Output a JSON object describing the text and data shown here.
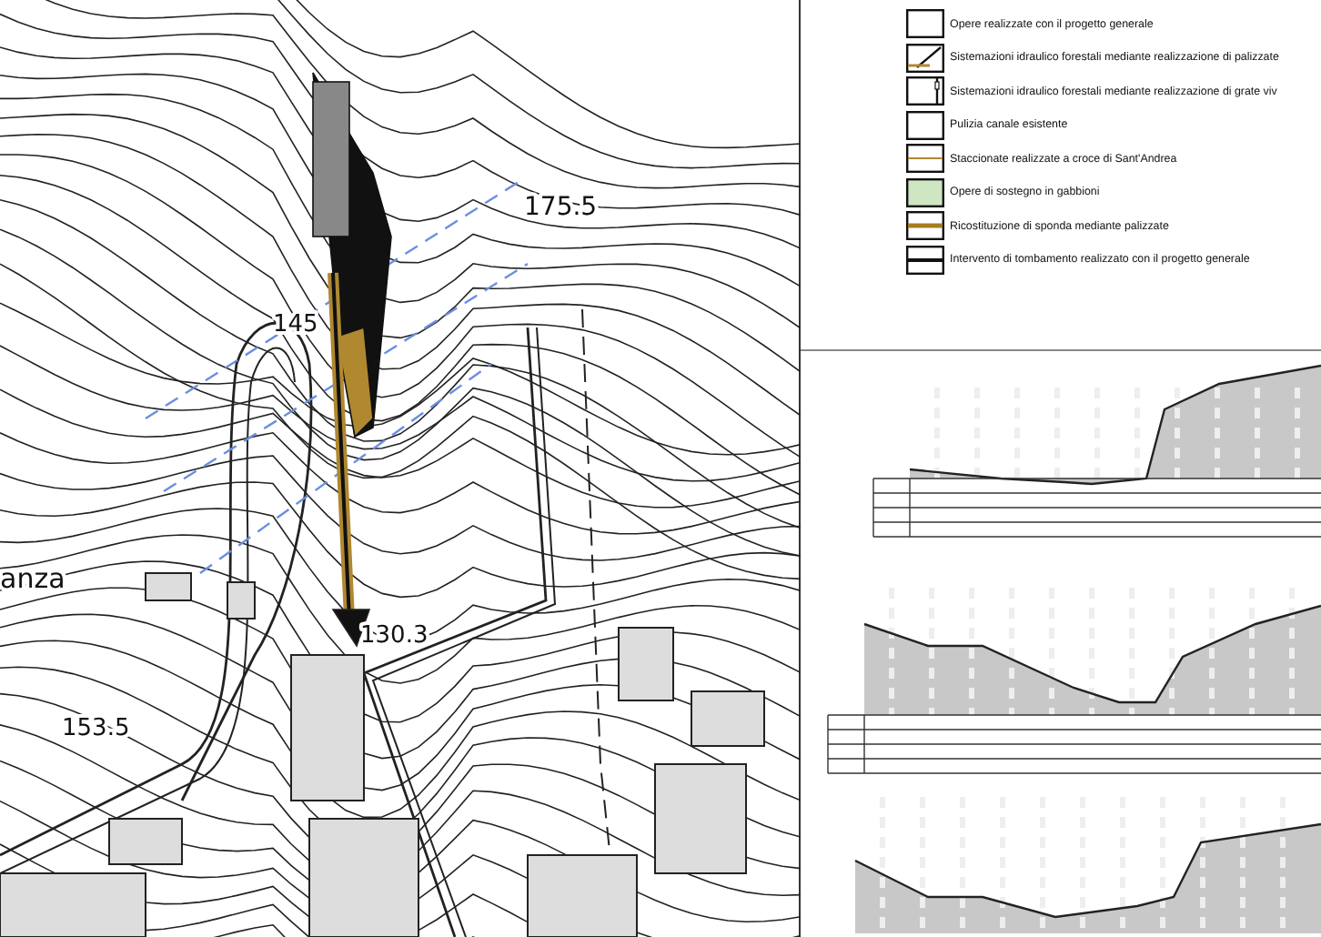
{
  "map": {
    "place_label": "anza",
    "elevations": [
      {
        "text": "175.5"
      },
      {
        "text": "145"
      },
      {
        "text": "130.3"
      },
      {
        "text": "153.5"
      }
    ]
  },
  "legend": [
    {
      "kind": "empty",
      "label": "Opere realizzate con il progetto generale"
    },
    {
      "kind": "hatch",
      "label": "Sistemazioni idraulico forestali mediante realizzazione di  palizzate"
    },
    {
      "kind": "post",
      "label": "Sistemazioni idraulico forestali mediante realizzazione di grate viv"
    },
    {
      "kind": "empty",
      "label": "Pulizia canale esistente"
    },
    {
      "kind": "thin-line",
      "label": "Staccionate realizzate a croce di Sant'Andrea"
    },
    {
      "kind": "fill",
      "label": "Opere di sostegno in gabbioni"
    },
    {
      "kind": "thick-line",
      "label": "Ricostituzione di sponda mediante palizzate"
    },
    {
      "kind": "black-line",
      "label": "Intervento di tombamento realizzato con il progetto generale"
    }
  ]
}
